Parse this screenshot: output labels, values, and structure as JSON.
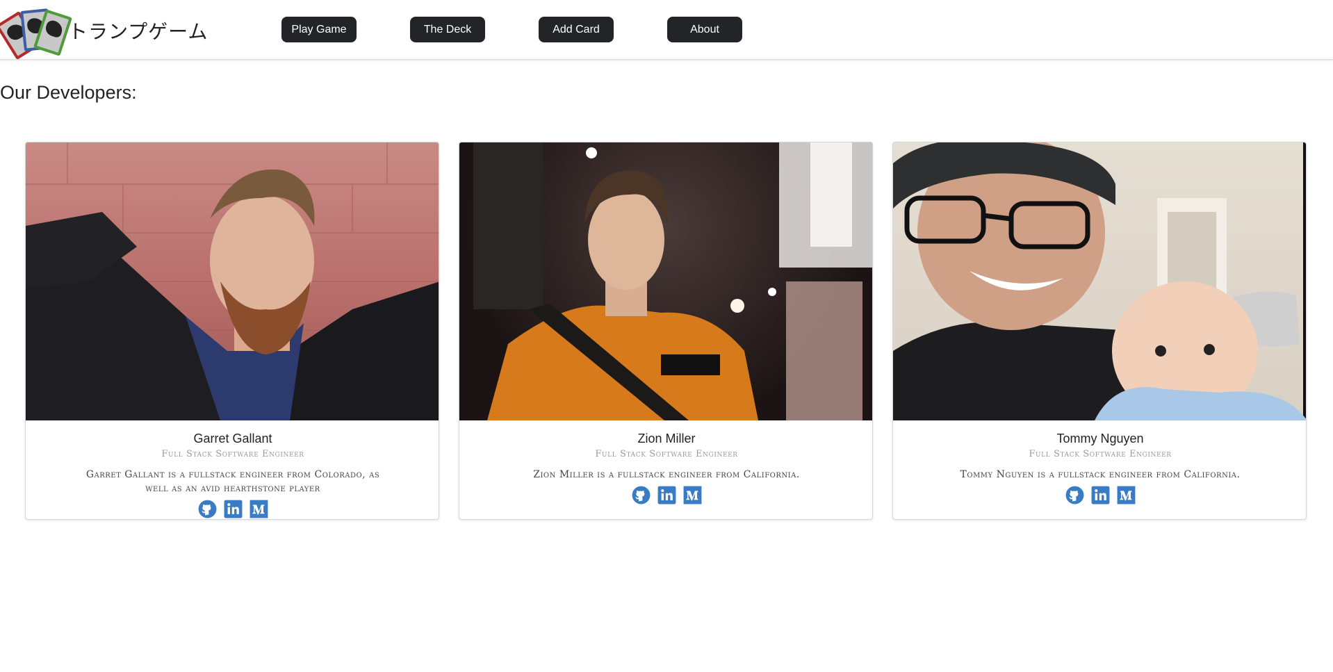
{
  "brand": {
    "title": "トランプゲーム",
    "logo_icon": "playing-cards-logo"
  },
  "nav": {
    "play_game": "Play Game",
    "the_deck": "The Deck",
    "add_card": "Add Card",
    "about": "About"
  },
  "heading": "Our Developers:",
  "developers": [
    {
      "name": "Garret Gallant",
      "role": "Full Stack Software Engineer",
      "bio": "Garret Gallant is a fullstack engineer from Colorado, as well as an avid hearthstone player",
      "links": [
        "github-icon",
        "linkedin-icon",
        "medium-icon"
      ]
    },
    {
      "name": "Zion Miller",
      "role": "Full Stack Software Engineer",
      "bio": "Zion Miller is a fullstack engineer from California.",
      "links": [
        "github-icon",
        "linkedin-icon",
        "medium-icon"
      ]
    },
    {
      "name": "Tommy Nguyen",
      "role": "Full Stack Software Engineer",
      "bio": "Tommy Nguyen is a fullstack engineer from California.",
      "links": [
        "github-icon",
        "linkedin-icon",
        "medium-icon"
      ]
    }
  ],
  "colors": {
    "nav_button": "#232428",
    "icon_blue": "#3a7cc4",
    "card_border": "#d6d6d6"
  }
}
